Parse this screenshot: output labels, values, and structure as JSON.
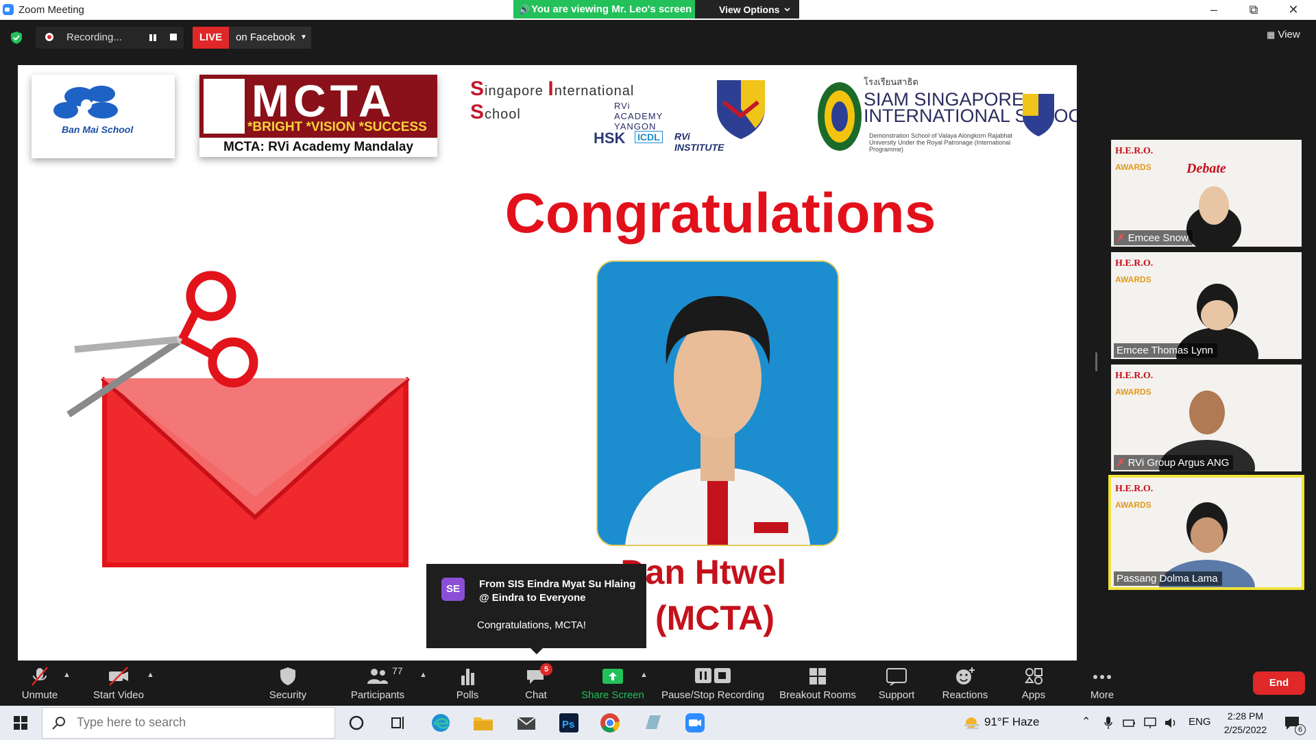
{
  "window": {
    "title": "Zoom Meeting"
  },
  "banner": {
    "viewing_text": "You are viewing Mr. Leo's screen",
    "view_options": "View Options"
  },
  "status": {
    "recording_text": "Recording...",
    "live_label": "LIVE",
    "live_destination": "on Facebook",
    "view_label": "View"
  },
  "shared_screen": {
    "logos": {
      "banmai": "Ban Mai School",
      "mcta_big": "MCTA",
      "mcta_motto": "*BRIGHT *VISION *SUCCESS",
      "mcta_foot": "MCTA: RVi Academy  Mandalay",
      "sis_name_1": "S",
      "sis_name_2": "ingapore ",
      "sis_name_3": "I",
      "sis_name_4": "nternational ",
      "sis_name_5": "S",
      "sis_name_6": "chool",
      "sis_sub": "RVi ACADEMY YANGON",
      "partner_hsk": "HSK",
      "partner_icdl": "ICDL",
      "partner_rvi": "RVi INSTITUTE",
      "siam_big": "SIAM SINGAPORE\nINTERNATIONAL SCHOOL",
      "siam_small": "Demonstration School of Valaya Alongkorn Rajabhat University Under the Royal Patronage (International Programme)"
    },
    "heading": "Congratulations",
    "name_line1": "o Dan Htwel",
    "name_line2": "(MCTA)"
  },
  "chat_toast": {
    "avatar": "SE",
    "from": "From SIS Eindra Myat Su Hlaing @ Eindra to Everyone",
    "message": "Congratulations, MCTA!"
  },
  "gallery": [
    {
      "name": "Emcee Snow",
      "muted": true,
      "active": false
    },
    {
      "name": "Emcee Thomas Lynn",
      "muted": false,
      "active": false
    },
    {
      "name": "RVi Group Argus ANG",
      "muted": true,
      "active": false
    },
    {
      "name": "Passang Dolma Lama",
      "muted": false,
      "active": true
    }
  ],
  "toolbar": {
    "unmute": "Unmute",
    "start_video": "Start Video",
    "security": "Security",
    "participants": "Participants",
    "participants_count": "77",
    "polls": "Polls",
    "chat": "Chat",
    "chat_badge": "5",
    "share_screen": "Share Screen",
    "pause_stop_recording": "Pause/Stop Recording",
    "breakout_rooms": "Breakout Rooms",
    "support": "Support",
    "reactions": "Reactions",
    "apps": "Apps",
    "more": "More",
    "end": "End"
  },
  "taskbar": {
    "search_placeholder": "Type here to search",
    "weather": "91°F  Haze",
    "language": "ENG",
    "time": "2:28 PM",
    "date": "2/25/2022",
    "notifications": "6"
  },
  "colors": {
    "accent_green": "#23c15a",
    "end_red": "#e02828",
    "congrats_red": "#e2101b",
    "active_tile": "#f1e23a"
  }
}
